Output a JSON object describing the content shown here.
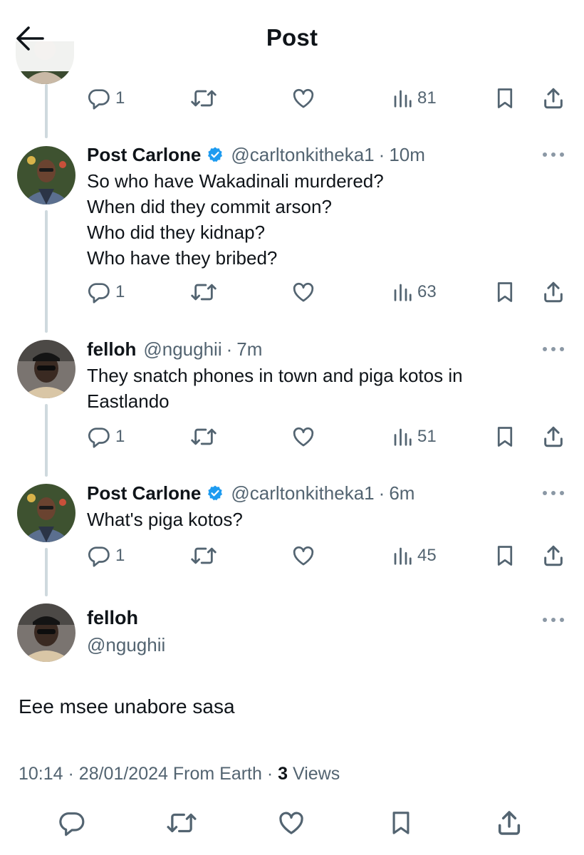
{
  "header": {
    "title": "Post",
    "back_icon": "arrow-left-icon"
  },
  "colors": {
    "text": "#0f1419",
    "secondary": "#536471",
    "verified": "#1d9bf0",
    "thread_line": "#cfd9de"
  },
  "top_partial": {
    "stats": {
      "replies": "1",
      "views": "81"
    }
  },
  "tweets": [
    {
      "name": "Post Carlone",
      "verified": true,
      "handle": "@carltonkitheka1",
      "time": "10m",
      "lines": [
        "So who have Wakadinali murdered?",
        "When did they commit arson?",
        "Who did they kidnap?",
        "Who have they bribed?"
      ],
      "replies": "1",
      "views": "63"
    },
    {
      "name": "felloh",
      "verified": false,
      "handle": "@ngughii",
      "time": "7m",
      "lines": [
        "They snatch phones in town and piga kotos in",
        "Eastlando"
      ],
      "replies": "1",
      "views": "51"
    },
    {
      "name": "Post Carlone",
      "verified": true,
      "handle": "@carltonkitheka1",
      "time": "6m",
      "lines": [
        "What's piga kotos?"
      ],
      "replies": "1",
      "views": "45"
    }
  ],
  "main_post": {
    "name": "felloh",
    "handle": "@ngughii",
    "text": "Eee msee unabore sasa",
    "meta": {
      "time": "10:14",
      "date": "28/01/2024",
      "source": "From Earth",
      "views_count": "3",
      "views_label": "Views"
    }
  }
}
